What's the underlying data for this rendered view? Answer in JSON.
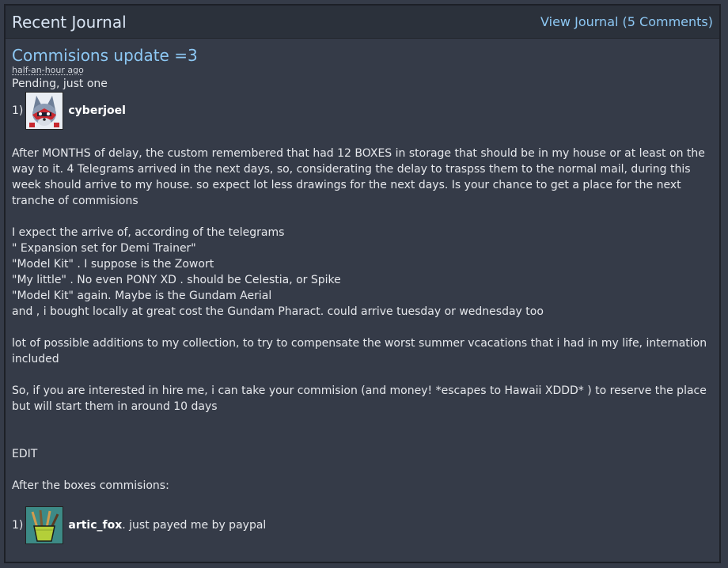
{
  "header": {
    "title": "Recent Journal",
    "view_link": "View Journal (5 Comments)"
  },
  "journal": {
    "title": "Commisions update =3",
    "timestamp": "half-an-hour ago",
    "pending_label": "Pending, just one",
    "pending_item": {
      "num": "1)",
      "username": "cyberjoel",
      "note": ""
    },
    "paragraphs": {
      "p1": "After MONTHS of delay, the custom remembered that had 12 BOXES in storage that should be in my house or at least on the way to it. 4 Telegrams arrived in the next days, so, considerating the delay to traspss them to the normal mail, during this week should arrive to my house. so expect lot less drawings for the next days. Is your chance to get a place for the next tranche of commisions",
      "p2_intro": "I expect the arrive of, according of the telegrams",
      "p2_l1": "\" Expansion set for Demi Trainer\"",
      "p2_l2": "\"Model Kit\" . I suppose is the Zowort",
      "p2_l3": "\"My little\" . No even PONY XD . should be Celestia, or Spike",
      "p2_l4": "\"Model Kit\" again. Maybe is the Gundam Aerial",
      "p2_l5": "and , i bought locally at great cost the Gundam Pharact. could arrive tuesday or wednesday too",
      "p3": "lot of possible additions to my collection, to try to compensate the worst summer vcacations that i had in my life, internation included",
      "p4": "So, if you are interested in hire me, i can take your commision (and money! *escapes to Hawaii XDDD* ) to reserve the place but will start them in around 10 days",
      "edit": "EDIT",
      "after": "After the boxes commisions:"
    },
    "after_item": {
      "num": "1)",
      "username": "artic_fox",
      "note": ". just payed me by paypal"
    }
  },
  "colors": {
    "background": "#353b48",
    "header_bg": "#2b313b",
    "link": "#8dc8f4",
    "text": "#e6e8ec"
  }
}
